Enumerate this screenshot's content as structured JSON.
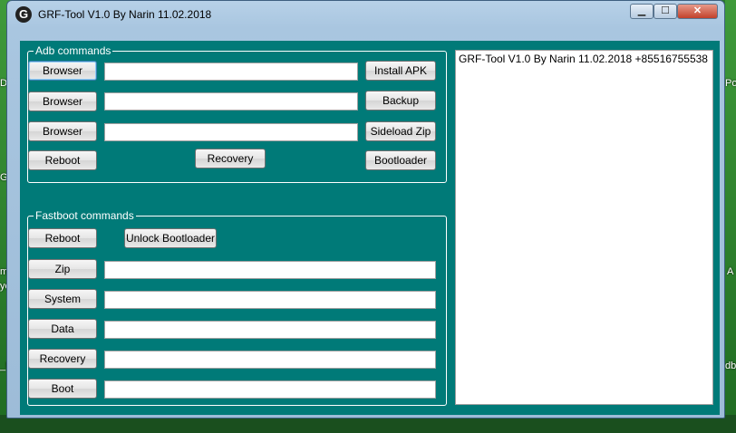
{
  "window": {
    "title": "GRF-Tool V1.0 By Narin 11.02.2018",
    "app_icon": "G"
  },
  "controls": {
    "minimize": "▁",
    "maximize": "☐",
    "close": "✕"
  },
  "adb": {
    "title": "Adb commands",
    "browser1": "Browser",
    "browser2": "Browser",
    "browser3": "Browser",
    "reboot": "Reboot",
    "recovery": "Recovery",
    "install_apk": "Install APK",
    "backup": "Backup",
    "sideload_zip": "Sideload Zip",
    "bootloader": "Bootloader",
    "path1": "",
    "path2": "",
    "path3": ""
  },
  "fastboot": {
    "title": "Fastboot commands",
    "reboot": "Reboot",
    "unlock_bootloader": "Unlock Bootloader",
    "zip": "Zip",
    "system": "System",
    "data": "Data",
    "recovery": "Recovery",
    "boot": "Boot",
    "zip_path": "",
    "system_path": "",
    "data_path": "",
    "recovery_path": "",
    "boot_path": ""
  },
  "log": {
    "text": "GRF-Tool V1.0 By Narin 11.02.2018 +85516755538"
  },
  "desktop": {
    "left_labels": [
      "Di",
      "GG",
      "me",
      "ye",
      "_M"
    ],
    "right_labels": [
      "Po",
      "A",
      "db"
    ]
  }
}
